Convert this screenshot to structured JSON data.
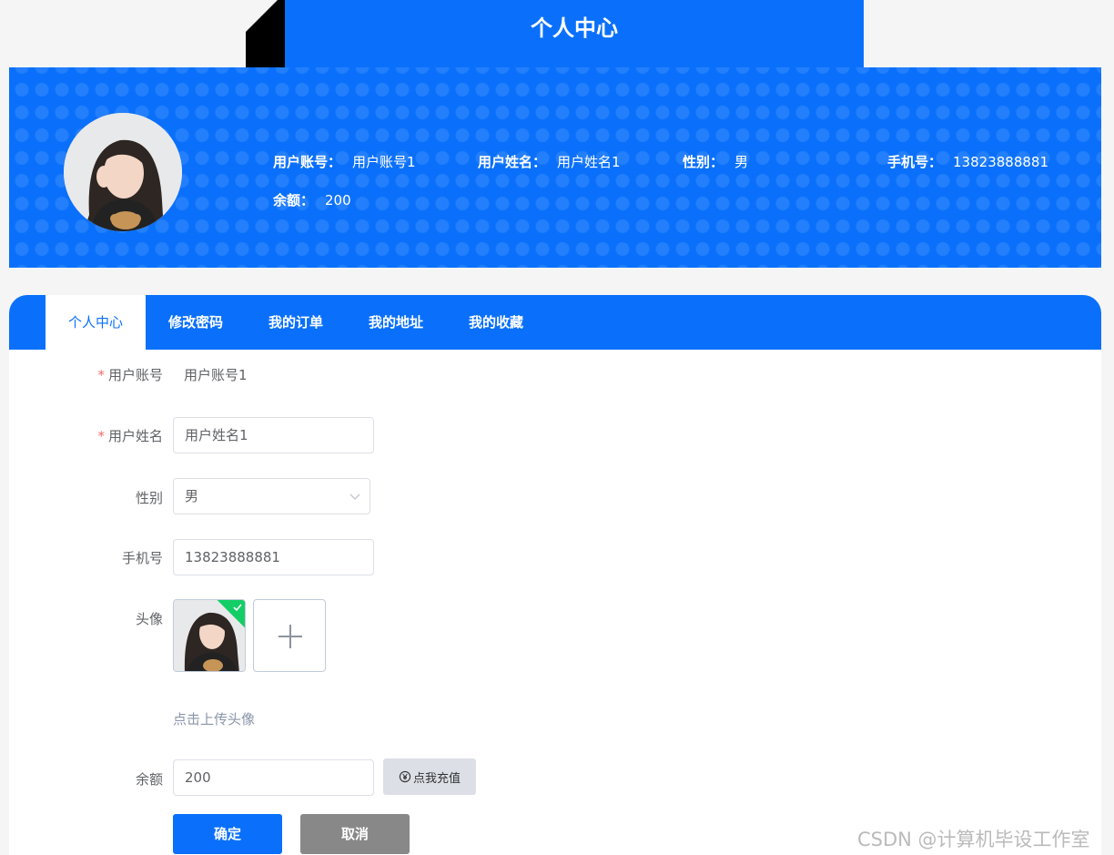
{
  "page": {
    "title": "个人中心"
  },
  "colors": {
    "primary": "#0a70fb",
    "cancel": "#888888",
    "required": "#f56c6c",
    "success_badge": "#13ce66"
  },
  "banner": {
    "avatar_icon": "user-avatar-photo",
    "account_label": "用户账号：",
    "account_value": "用户账号1",
    "name_label": "用户姓名：",
    "name_value": "用户姓名1",
    "gender_label": "性别：",
    "gender_value": "男",
    "phone_label": "手机号：",
    "phone_value": "13823888881",
    "balance_label": "余额：",
    "balance_value": "200"
  },
  "tabs": [
    {
      "label": "个人中心",
      "active": true
    },
    {
      "label": "修改密码",
      "active": false
    },
    {
      "label": "我的订单",
      "active": false
    },
    {
      "label": "我的地址",
      "active": false
    },
    {
      "label": "我的收藏",
      "active": false
    }
  ],
  "form": {
    "required_mark": "*",
    "account": {
      "label": "用户账号",
      "value": "用户账号1"
    },
    "name": {
      "label": "用户姓名",
      "value": "用户姓名1"
    },
    "gender": {
      "label": "性别",
      "value": "男"
    },
    "phone": {
      "label": "手机号",
      "value": "13823888881"
    },
    "avatar": {
      "label": "头像",
      "hint": "点击上传头像",
      "plus_icon": "plus-icon",
      "check_icon": "check-icon"
    },
    "balance": {
      "label": "余额",
      "value": "200",
      "recharge_label": "点我充值",
      "recharge_icon": "yen-coin-icon"
    },
    "submit_label": "确定",
    "cancel_label": "取消"
  },
  "watermark": "CSDN @计算机毕设工作室"
}
